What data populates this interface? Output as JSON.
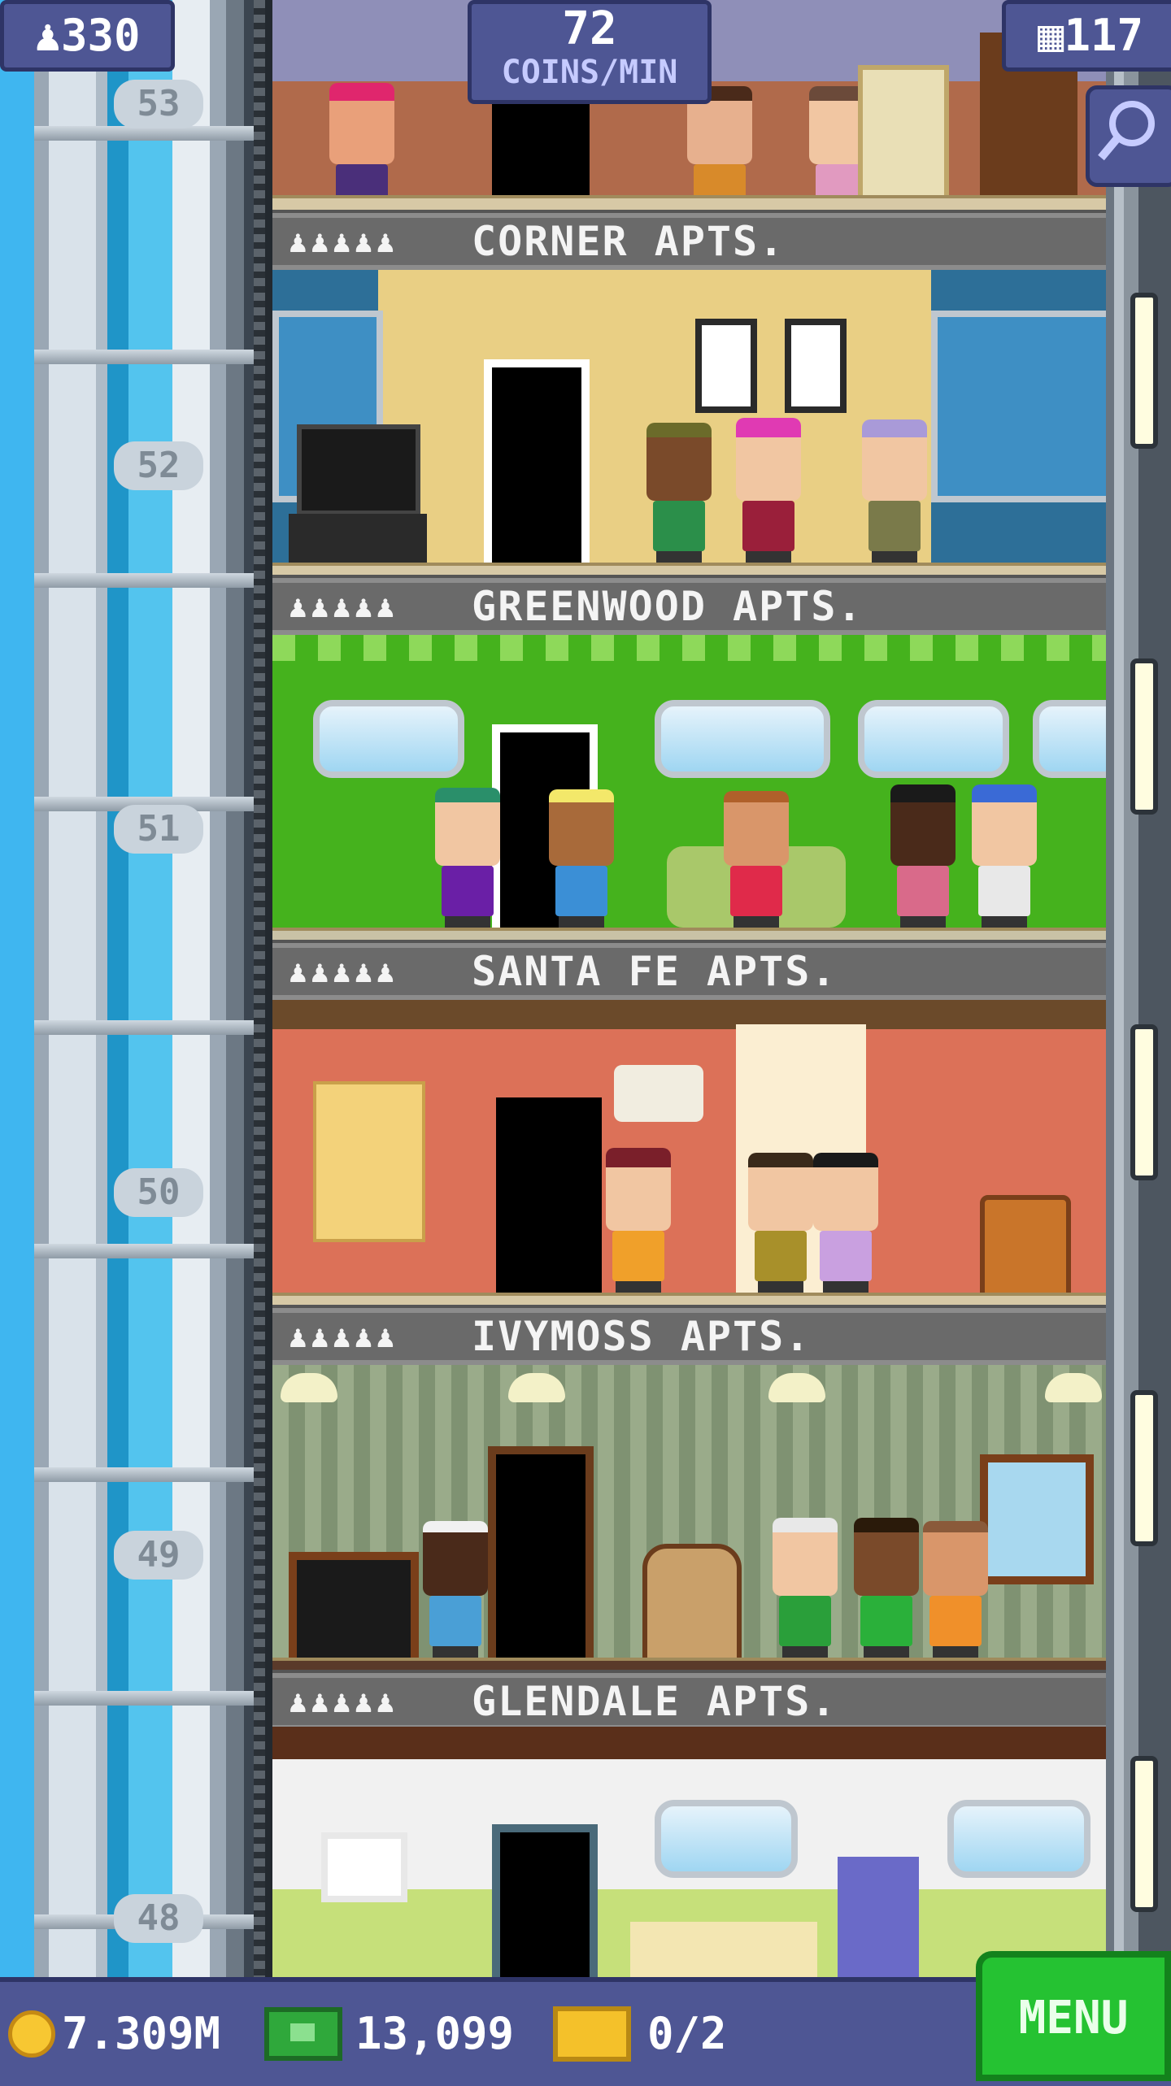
{
  "hud": {
    "population": "330",
    "coins_per_min_value": "72",
    "coins_per_min_label": "COINS/MIN",
    "floor_count": "117"
  },
  "floors": [
    {
      "number": "53",
      "sign_name": "CORNER APTS."
    },
    {
      "number": "52",
      "sign_name": "GREENWOOD APTS."
    },
    {
      "number": "51",
      "sign_name": "SANTA FE APTS."
    },
    {
      "number": "50",
      "sign_name": "IVYMOSS APTS."
    },
    {
      "number": "49",
      "sign_name": "GLENDALE APTS."
    },
    {
      "number": "48",
      "sign_name": ""
    }
  ],
  "resident_icons": "♟♟♟♟♟",
  "bottom_bar": {
    "coins": "7.309M",
    "tower_bux": "13,099",
    "vip_tickets": "0/2",
    "menu_label": "MENU"
  },
  "colors": {
    "hud_bg": "#4e5694",
    "menu_green": "#25c232",
    "sky_blue": "#3fb6f0"
  },
  "icons": [
    "person-icon",
    "building-icon",
    "search-icon",
    "coin-icon",
    "bux-icon",
    "ticket-icon"
  ]
}
